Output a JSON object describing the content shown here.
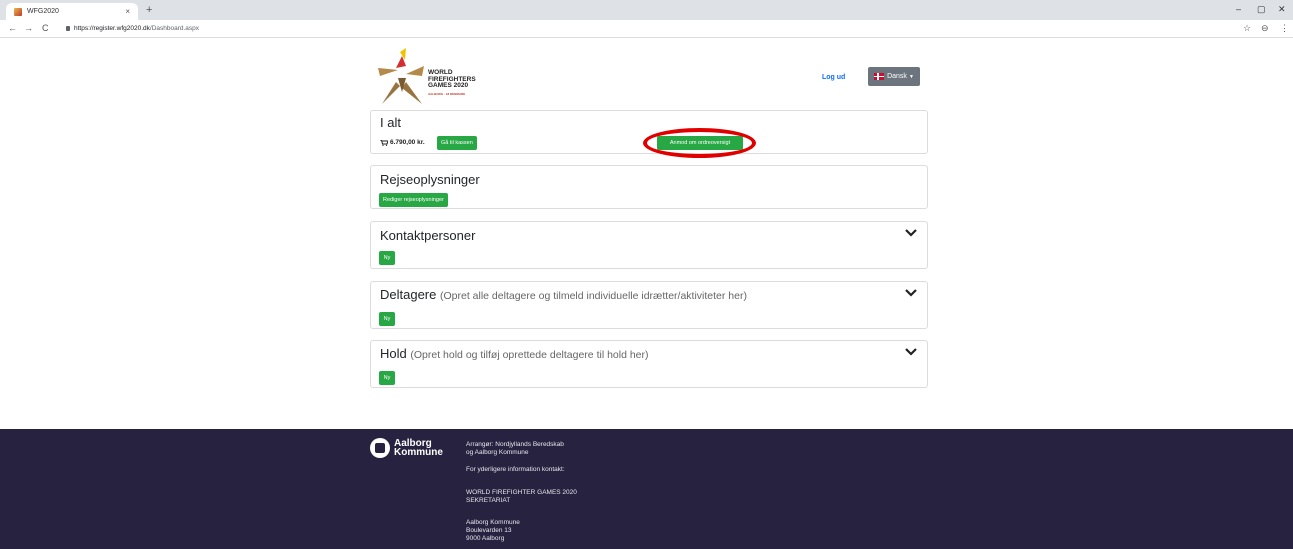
{
  "browser": {
    "tab_title": "WFG2020",
    "tab_close": "×",
    "new_tab": "+",
    "win_min": "–",
    "win_max": "▢",
    "win_close": "✕",
    "url_host": "https://register.wfg2020.dk",
    "url_path": "/Dashboard.aspx",
    "back": "←",
    "forward": "→",
    "reload": "C",
    "star": "☆",
    "profile": "⊖",
    "menu": "⋮"
  },
  "header": {
    "logo_line1": "WORLD",
    "logo_line2": "FIREFIGHTERS",
    "logo_line3": "GAMES 2020",
    "logo_sub": "AALBORG · 18 DENMARK",
    "logout": "Log ud",
    "language": "Dansk"
  },
  "summary": {
    "title": "I alt",
    "amount": "6.790,00 kr.",
    "checkout_button": "Gå til kassen",
    "overview_button": "Anmod om ordreoversigt"
  },
  "travel": {
    "title": "Rejseoplysninger",
    "edit_button": "Rediger rejseoplysninger"
  },
  "contacts": {
    "title": "Kontaktpersoner",
    "new_button": "Ny"
  },
  "participants": {
    "title": "Deltagere",
    "hint": "(Opret alle deltagere og tilmeld individuelle idrætter/aktiviteter her)",
    "new_button": "Ny"
  },
  "teams": {
    "title": "Hold",
    "hint": "(Opret hold og tilføj oprettede deltagere til hold her)",
    "new_button": "Ny"
  },
  "footer": {
    "logo_line1": "Aalborg",
    "logo_line2": "Kommune",
    "organizer_1": "Arrangør: Nordjyllands Beredskab",
    "organizer_2": "og Aalborg Kommune",
    "more_info": "For yderligere information kontakt:",
    "secretariat_1": "WORLD FIREFIGHTER GAMES 2020",
    "secretariat_2": "SEKRETARIAT",
    "address_1": "Aalborg Kommune",
    "address_2": "Boulevarden 13",
    "address_3": "9000 Aalborg"
  },
  "colors": {
    "accent_green": "#28a745",
    "link_blue": "#0d6efd",
    "footer_bg": "#26223f",
    "highlight_red": "#e00000"
  }
}
